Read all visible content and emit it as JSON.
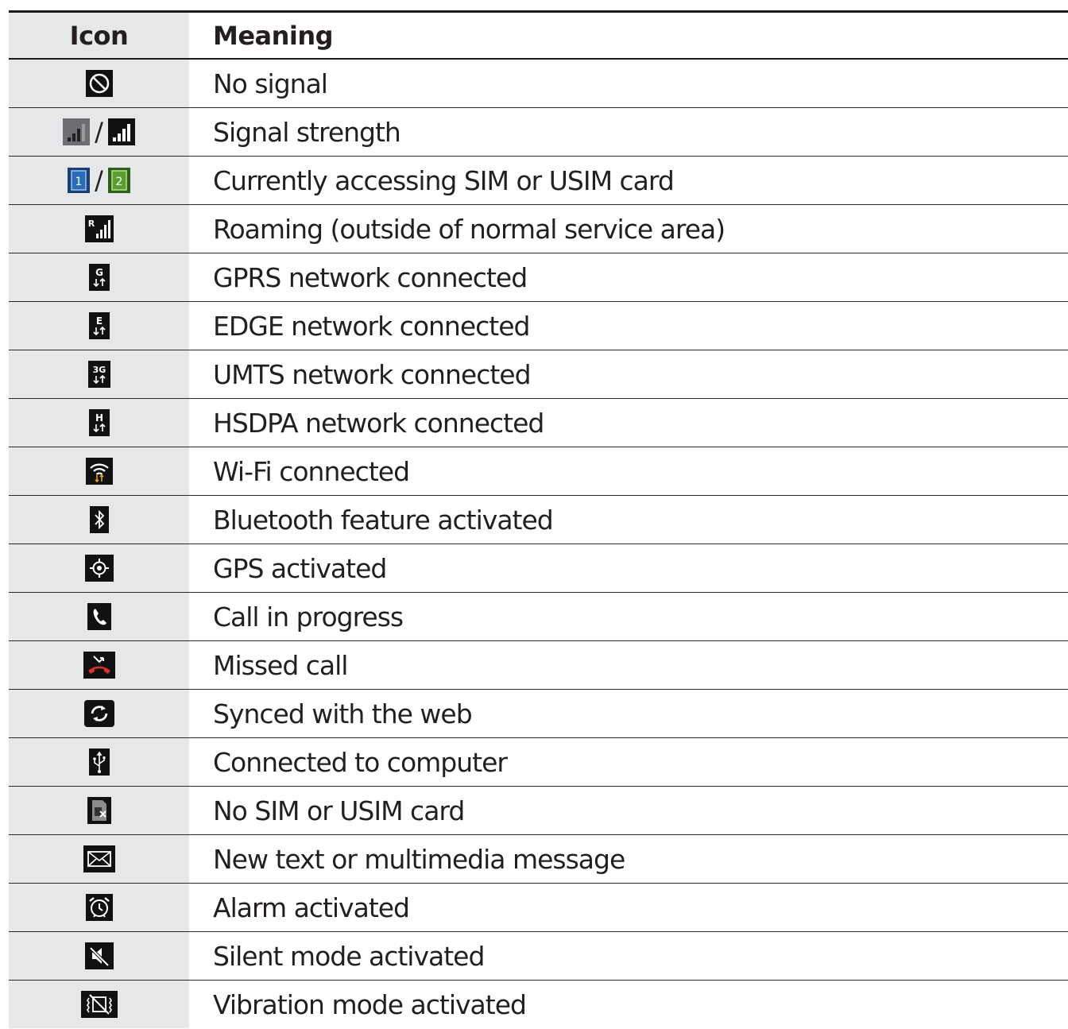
{
  "header": {
    "icon": "Icon",
    "meaning": "Meaning"
  },
  "rows": [
    {
      "icon": "no-signal-icon",
      "meaning": "No signal"
    },
    {
      "icon": "signal-strength-icon",
      "meaning": "Signal strength"
    },
    {
      "icon": "sim-card-icon",
      "meaning": "Currently accessing SIM or USIM card",
      "sim_labels": [
        "1",
        "2"
      ]
    },
    {
      "icon": "roaming-icon",
      "meaning": "Roaming (outside of normal service area)",
      "badge": "R"
    },
    {
      "icon": "gprs-icon",
      "meaning": "GPRS network connected",
      "badge": "G"
    },
    {
      "icon": "edge-icon",
      "meaning": "EDGE network connected",
      "badge": "E"
    },
    {
      "icon": "umts-icon",
      "meaning": "UMTS network connected",
      "badge": "3G"
    },
    {
      "icon": "hsdpa-icon",
      "meaning": "HSDPA network connected",
      "badge": "H"
    },
    {
      "icon": "wifi-icon",
      "meaning": "Wi-Fi connected"
    },
    {
      "icon": "bluetooth-icon",
      "meaning": "Bluetooth feature activated"
    },
    {
      "icon": "gps-icon",
      "meaning": "GPS activated"
    },
    {
      "icon": "call-icon",
      "meaning": "Call in progress"
    },
    {
      "icon": "missed-call-icon",
      "meaning": "Missed call"
    },
    {
      "icon": "sync-icon",
      "meaning": "Synced with the web"
    },
    {
      "icon": "usb-icon",
      "meaning": "Connected to computer"
    },
    {
      "icon": "no-sim-icon",
      "meaning": "No SIM or USIM card"
    },
    {
      "icon": "message-icon",
      "meaning": "New text or multimedia message"
    },
    {
      "icon": "alarm-icon",
      "meaning": "Alarm activated"
    },
    {
      "icon": "silent-mode-icon",
      "meaning": "Silent mode activated"
    },
    {
      "icon": "vibration-mode-icon",
      "meaning": "Vibration mode activated"
    }
  ],
  "colors": {
    "icon_column_bg": "#e6e7e8",
    "sim1": "#2a6db8",
    "sim2": "#5a9e2f",
    "missed_call": "#d9342b",
    "wifi_arrows": "#e8a317"
  }
}
